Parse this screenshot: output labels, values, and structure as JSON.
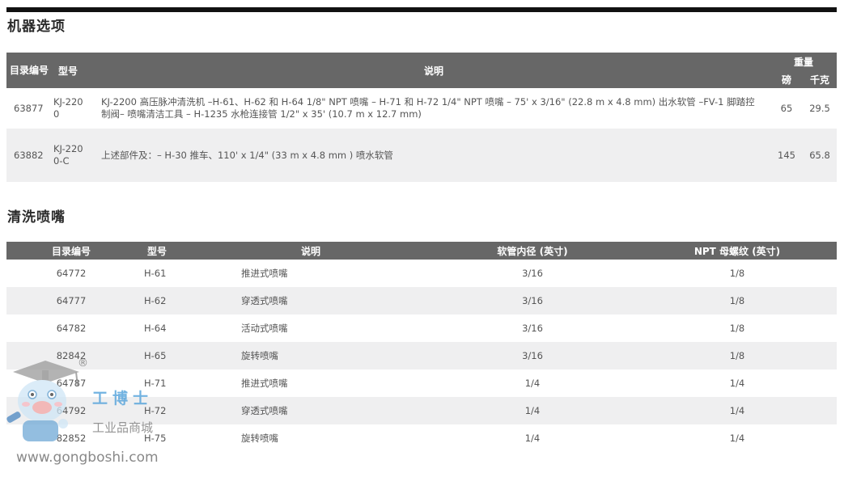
{
  "machine_options": {
    "title": "机器选项",
    "headers": {
      "catalog": "目录编号",
      "model": "型号",
      "description": "说明",
      "weight": "重量",
      "lbs": "磅",
      "kg": "千克"
    },
    "rows": [
      {
        "catalog": "63877",
        "model": "KJ-2200",
        "description": "KJ-2200 高压脉冲清洗机 –H-61、H-62 和 H-64 1/8\" NPT 喷嘴 – H-71 和 H-72 1/4\" NPT 喷嘴 – 75' x 3/16\" (22.8 m x 4.8 mm) 出水软管 –FV-1 脚踏控制阀– 喷嘴清洁工具 – H-1235 水枪连接管 1/2\" x 35' (10.7 m x 12.7 mm)",
        "lbs": "65",
        "kg": "29.5"
      },
      {
        "catalog": "63882",
        "model": "KJ-2200-C",
        "description": "上述部件及：– H-30 推车、110' x 1/4\" (33 m x 4.8 mm ) 喷水软管",
        "lbs": "145",
        "kg": "65.8"
      }
    ]
  },
  "nozzles": {
    "title": "清洗喷嘴",
    "headers": {
      "catalog": "目录编号",
      "model": "型号",
      "description": "说明",
      "hose_id": "软管内径 (英寸)",
      "npt": "NPT 母螺纹 (英寸)"
    },
    "rows": [
      {
        "catalog": "64772",
        "model": "H-61",
        "description": "推进式喷嘴",
        "hose_id": "3/16",
        "npt": "1/8"
      },
      {
        "catalog": "64777",
        "model": "H-62",
        "description": "穿透式喷嘴",
        "hose_id": "3/16",
        "npt": "1/8"
      },
      {
        "catalog": "64782",
        "model": "H-64",
        "description": "活动式喷嘴",
        "hose_id": "3/16",
        "npt": "1/8"
      },
      {
        "catalog": "82842",
        "model": "H-65",
        "description": "旋转喷嘴",
        "hose_id": "3/16",
        "npt": "1/8"
      },
      {
        "catalog": "64787",
        "model": "H-71",
        "description": "推进式喷嘴",
        "hose_id": "1/4",
        "npt": "1/4"
      },
      {
        "catalog": "64792",
        "model": "H-72",
        "description": "穿透式喷嘴",
        "hose_id": "1/4",
        "npt": "1/4"
      },
      {
        "catalog": "82852",
        "model": "H-75",
        "description": "旋转喷嘴",
        "hose_id": "1/4",
        "npt": "1/4"
      }
    ]
  },
  "watermark": {
    "brand": "工博士",
    "tagline": "工业品商城",
    "url": "www.gongboshi.com",
    "registered": "®"
  }
}
